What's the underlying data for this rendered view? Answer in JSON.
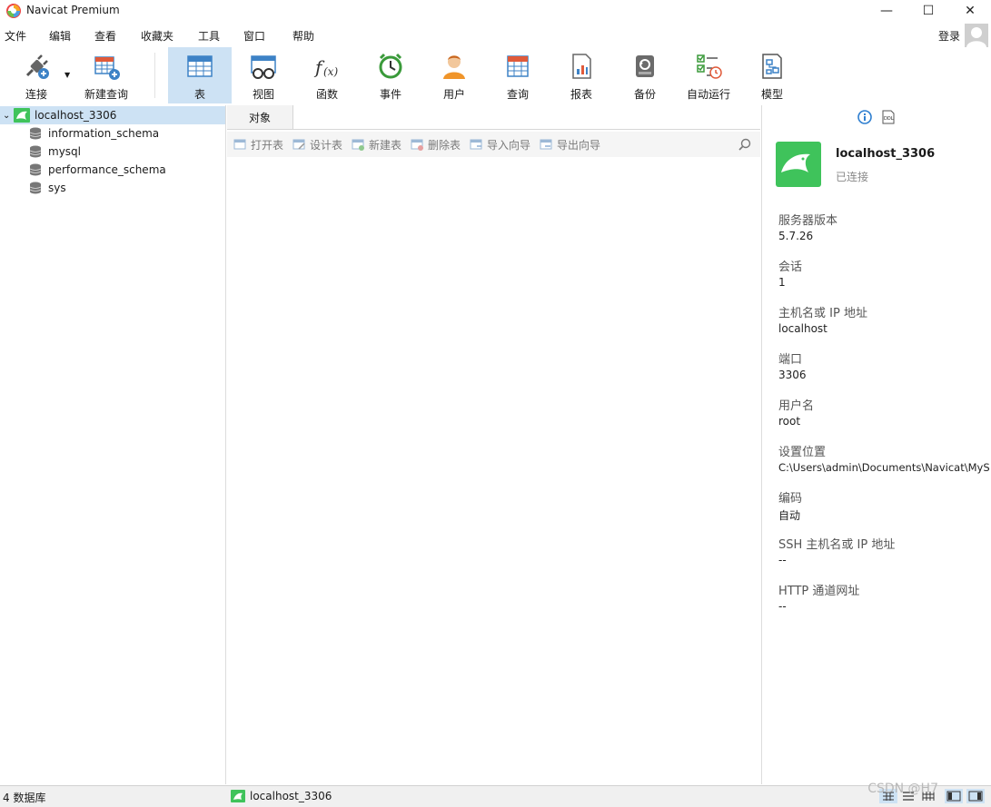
{
  "window": {
    "title": "Navicat Premium",
    "minimize": "—",
    "maximize": "☐",
    "close": "✕"
  },
  "menu": {
    "items": [
      "文件",
      "编辑",
      "查看",
      "收藏夹",
      "工具",
      "窗口",
      "帮助"
    ],
    "login": "登录"
  },
  "toolbar": {
    "buttons": [
      {
        "label": "连接",
        "icon": "plug-icon"
      },
      {
        "label": "新建查询",
        "icon": "new-query-icon"
      },
      {
        "label": "表",
        "icon": "table-icon",
        "active": true
      },
      {
        "label": "视图",
        "icon": "view-icon"
      },
      {
        "label": "函数",
        "icon": "function-icon"
      },
      {
        "label": "事件",
        "icon": "clock-icon"
      },
      {
        "label": "用户",
        "icon": "user-icon"
      },
      {
        "label": "查询",
        "icon": "query-icon"
      },
      {
        "label": "报表",
        "icon": "report-icon"
      },
      {
        "label": "备份",
        "icon": "backup-icon"
      },
      {
        "label": "自动运行",
        "icon": "automation-icon"
      },
      {
        "label": "模型",
        "icon": "model-icon"
      }
    ]
  },
  "tree": {
    "connection": "localhost_3306",
    "databases": [
      "information_schema",
      "mysql",
      "performance_schema",
      "sys"
    ]
  },
  "objects": {
    "tab": "对象",
    "actions": [
      "打开表",
      "设计表",
      "新建表",
      "删除表",
      "导入向导",
      "导出向导"
    ]
  },
  "info": {
    "name": "localhost_3306",
    "status": "已连接",
    "props": [
      {
        "label": "服务器版本",
        "value": "5.7.26"
      },
      {
        "label": "会话",
        "value": "1"
      },
      {
        "label": "主机名或 IP 地址",
        "value": "localhost"
      },
      {
        "label": "端口",
        "value": "3306"
      },
      {
        "label": "用户名",
        "value": "root"
      },
      {
        "label": "设置位置",
        "value": "C:\\Users\\admin\\Documents\\Navicat\\MySQL"
      },
      {
        "label": "编码",
        "value": "自动"
      },
      {
        "label": "SSH 主机名或 IP 地址",
        "value": "--"
      },
      {
        "label": "HTTP 通道网址",
        "value": "--"
      }
    ]
  },
  "status": {
    "left": "4 数据库",
    "connection": "localhost_3306",
    "watermark": "CSDN @H7"
  },
  "colors": {
    "accent": "#cde2f4",
    "mysql_green": "#3fc35b",
    "table_blue": "#3d82c6"
  }
}
